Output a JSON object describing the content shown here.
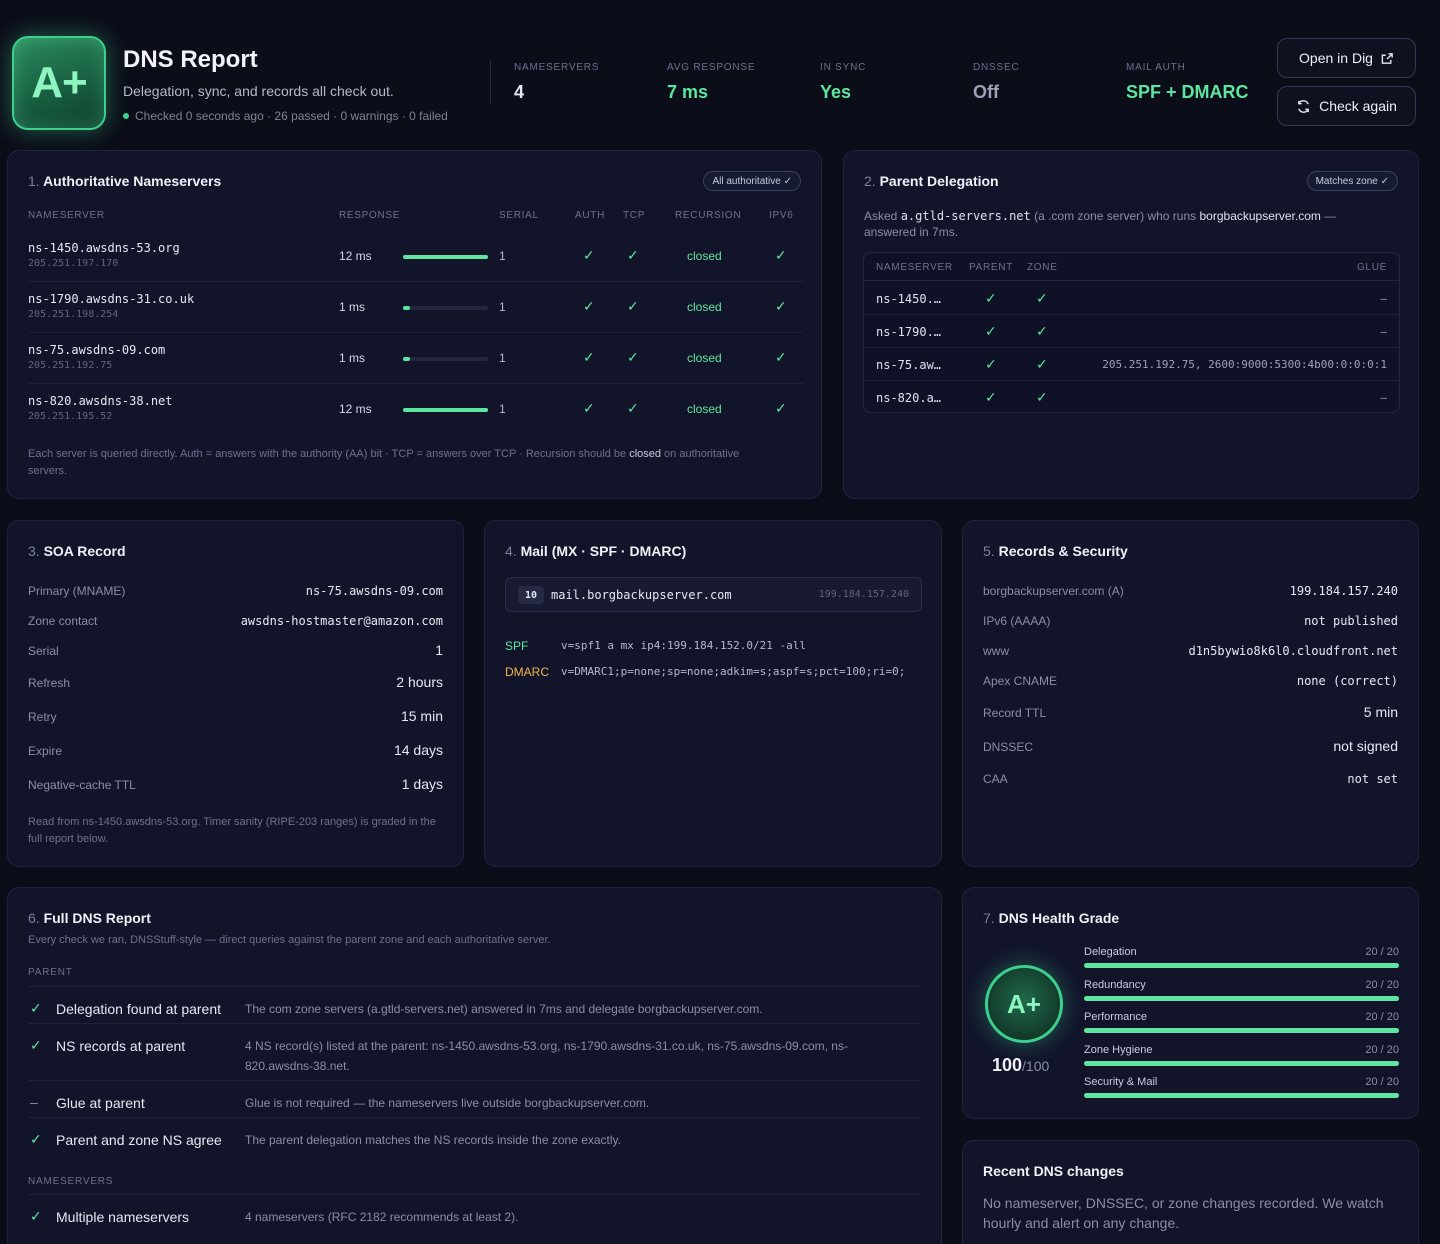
{
  "header": {
    "grade": "A+",
    "title": "DNS Report",
    "subtitle": "Delegation, sync, and records all check out.",
    "status": "Checked 0 seconds ago · 26 passed · 0 warnings · 0 failed",
    "stats": [
      {
        "label": "NAMESERVERS",
        "value": "4",
        "color": "#e6e8f0"
      },
      {
        "label": "AVG RESPONSE",
        "value": "7 ms",
        "color": "#5ee6a0"
      },
      {
        "label": "IN SYNC",
        "value": "Yes",
        "color": "#5ee6a0"
      },
      {
        "label": "DNSSEC",
        "value": "Off",
        "color": "#9da2b8"
      },
      {
        "label": "MAIL AUTH",
        "value": "SPF + DMARC",
        "color": "#5ee6a0"
      }
    ],
    "open_label": "Open in Dig",
    "check_label": "Check again"
  },
  "ns": {
    "num": "1.",
    "title": "Authoritative Nameservers",
    "badge": "All authoritative ✓",
    "headers": {
      "nameserver": "NAMESERVER",
      "response": "RESPONSE",
      "serial": "SERIAL",
      "auth": "AUTH",
      "tcp": "TCP",
      "recursion": "RECURSION",
      "ipv6": "IPV6"
    },
    "rows": [
      {
        "name": "ns-1450.awsdns-53.org",
        "ip": "205.251.197.170",
        "response": "12 ms",
        "response_fraction": 1.0,
        "serial": "1",
        "auth": "✓",
        "tcp": "✓",
        "recursion": "closed",
        "ipv6": "✓"
      },
      {
        "name": "ns-1790.awsdns-31.co.uk",
        "ip": "205.251.198.254",
        "response": "1 ms",
        "response_fraction": 0.08,
        "serial": "1",
        "auth": "✓",
        "tcp": "✓",
        "recursion": "closed",
        "ipv6": "✓"
      },
      {
        "name": "ns-75.awsdns-09.com",
        "ip": "205.251.192.75",
        "response": "1 ms",
        "response_fraction": 0.08,
        "serial": "1",
        "auth": "✓",
        "tcp": "✓",
        "recursion": "closed",
        "ipv6": "✓"
      },
      {
        "name": "ns-820.awsdns-38.net",
        "ip": "205.251.195.52",
        "response": "12 ms",
        "response_fraction": 1.0,
        "serial": "1",
        "auth": "✓",
        "tcp": "✓",
        "recursion": "closed",
        "ipv6": "✓"
      }
    ],
    "note_pre": "Each server is queried directly. Auth = answers with the authority (AA) bit · TCP = answers over TCP · Recursion should be ",
    "note_bold": "closed",
    "note_post": " on authoritative servers."
  },
  "parent": {
    "num": "2.",
    "title": "Parent Delegation",
    "badge": "Matches zone ✓",
    "asked": "Asked",
    "server": "a.gtld-servers.net",
    "mid": "(a .com zone server) who runs",
    "domain": "borgbackupserver.com",
    "tail": "— answered in 7ms.",
    "headers": {
      "nameserver": "NAMESERVER",
      "parent": "PARENT",
      "zone": "ZONE",
      "glue": "GLUE"
    },
    "rows": [
      {
        "ns": "ns-1450.…",
        "parent": "✓",
        "zone": "✓",
        "glue": "–"
      },
      {
        "ns": "ns-1790.…",
        "parent": "✓",
        "zone": "✓",
        "glue": "–"
      },
      {
        "ns": "ns-75.aw…",
        "parent": "✓",
        "zone": "✓",
        "glue": "205.251.192.75, 2600:9000:5300:4b00:0:0:0:1"
      },
      {
        "ns": "ns-820.a…",
        "parent": "✓",
        "zone": "✓",
        "glue": "–"
      }
    ]
  },
  "soa": {
    "num": "3.",
    "title": "SOA Record",
    "rows": [
      {
        "k": "Primary (MNAME)",
        "v": "ns-75.awsdns-09.com"
      },
      {
        "k": "Zone contact",
        "v": "awsdns-hostmaster@amazon.com"
      },
      {
        "k": "Serial",
        "v": "1"
      },
      {
        "k": "Refresh",
        "v": "2 hours"
      },
      {
        "k": "Retry",
        "v": "15 min"
      },
      {
        "k": "Expire",
        "v": "14 days"
      },
      {
        "k": "Negative-cache TTL",
        "v": "1 days"
      }
    ],
    "note": "Read from ns-1450.awsdns-53.org. Timer sanity (RIPE-203 ranges) is graded in the full report below."
  },
  "mail": {
    "num": "4.",
    "title": "Mail (MX · SPF · DMARC)",
    "mx_priority": "10",
    "mx_host": "mail.borgbackupserver.com",
    "mx_ip": "199.184.157.240",
    "spf_label": "SPF",
    "spf_value": "v=spf1 a mx ip4:199.184.152.0/21 -all",
    "dmarc_label": "DMARC",
    "dmarc_value": "v=DMARC1;p=none;sp=none;adkim=s;aspf=s;pct=100;ri=0;"
  },
  "records": {
    "num": "5.",
    "title": "Records & Security",
    "rows": [
      {
        "k": "borgbackupserver.com (A)",
        "v": "199.184.157.240"
      },
      {
        "k": "IPv6 (AAAA)",
        "v": "not published"
      },
      {
        "k": "www",
        "v": "d1n5bywio8k6l0.cloudfront.net"
      },
      {
        "k": "Apex CNAME",
        "v": "none (correct)"
      },
      {
        "k": "Record TTL",
        "v": "5 min"
      },
      {
        "k": "DNSSEC",
        "v": "not signed"
      },
      {
        "k": "CAA",
        "v": "not set"
      }
    ]
  },
  "full": {
    "num": "6.",
    "title": "Full DNS Report",
    "subtitle": "Every check we ran, DNSStuff-style — direct queries against the parent zone and each authoritative server.",
    "section_parent": "PARENT",
    "section_ns": "NAMESERVERS",
    "rows": [
      {
        "icon": "✓",
        "name": "Delegation found at parent",
        "desc": "The com zone servers (a.gtld-servers.net) answered in 7ms and delegate borgbackupserver.com."
      },
      {
        "icon": "✓",
        "name": "NS records at parent",
        "desc": "4 NS record(s) listed at the parent: ns-1450.awsdns-53.org, ns-1790.awsdns-31.co.uk, ns-75.awsdns-09.com, ns-820.awsdns-38.net."
      },
      {
        "icon": "–",
        "name": "Glue at parent",
        "desc": "Glue is not required — the nameservers live outside borgbackupserver.com."
      },
      {
        "icon": "✓",
        "name": "Parent and zone NS agree",
        "desc": "The parent delegation matches the NS records inside the zone exactly."
      },
      {
        "icon": "✓",
        "name": "Multiple nameservers",
        "desc": "4 nameservers (RFC 2182 recommends at least 2)."
      }
    ]
  },
  "health": {
    "num": "7.",
    "title": "DNS Health Grade",
    "grade": "A+",
    "score": "100",
    "score_max": "/100",
    "items": [
      {
        "name": "Delegation",
        "value": "20 / 20",
        "fraction": 1.0
      },
      {
        "name": "Redundancy",
        "value": "20 / 20",
        "fraction": 1.0
      },
      {
        "name": "Performance",
        "value": "20 / 20",
        "fraction": 1.0
      },
      {
        "name": "Zone Hygiene",
        "value": "20 / 20",
        "fraction": 1.0
      },
      {
        "name": "Security & Mail",
        "value": "20 / 20",
        "fraction": 1.0
      }
    ]
  },
  "recent": {
    "title": "Recent DNS changes",
    "text": "No nameserver, DNSSEC, or zone changes recorded. We watch hourly and alert on any change."
  }
}
